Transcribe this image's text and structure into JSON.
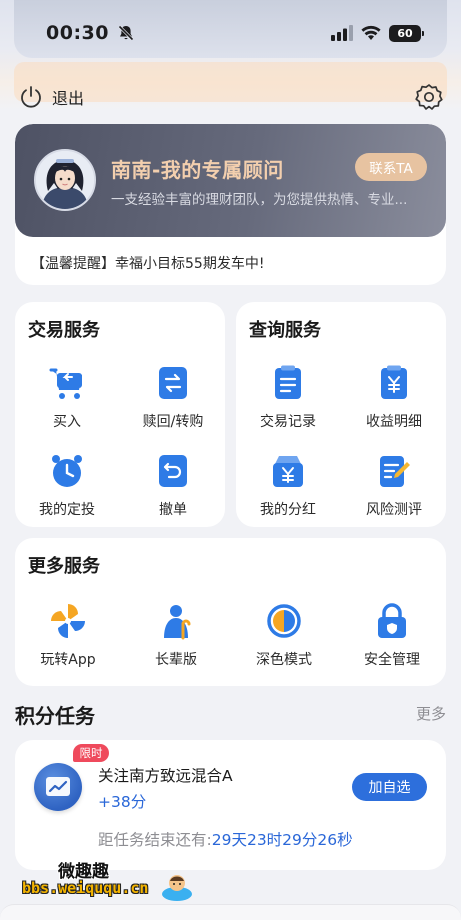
{
  "status_bar": {
    "time": "00:30",
    "battery": "60"
  },
  "header": {
    "logout_label": "退出"
  },
  "advisor": {
    "name": "南南-我的专属顾问",
    "description": "一支经验丰富的理财团队，为您提供热情、专业...",
    "contact_label": "联系TA",
    "notice": "【温馨提醒】幸福小目标55期发车中!"
  },
  "trade": {
    "title": "交易服务",
    "items": [
      "买入",
      "赎回/转购",
      "我的定投",
      "撤单"
    ]
  },
  "query": {
    "title": "查询服务",
    "items": [
      "交易记录",
      "收益明细",
      "我的分红",
      "风险测评"
    ]
  },
  "more_services": {
    "title": "更多服务",
    "items": [
      "玩转App",
      "长辈版",
      "深色模式",
      "安全管理"
    ]
  },
  "points": {
    "title": "积分任务",
    "more": "更多",
    "task": {
      "badge": "限时",
      "name": "关注南方致远混合A",
      "points": "+38分",
      "action": "加自选",
      "countdown_label": "距任务结束还有:",
      "countdown_value": "29天23时29分26秒"
    }
  },
  "watermark": {
    "line1": "微趣趣",
    "line2": "bbs.weiququ.cn"
  },
  "colors": {
    "accent": "#2d6fdc",
    "advisor_name": "#f3cfae",
    "badge": "#ef4a5c"
  }
}
